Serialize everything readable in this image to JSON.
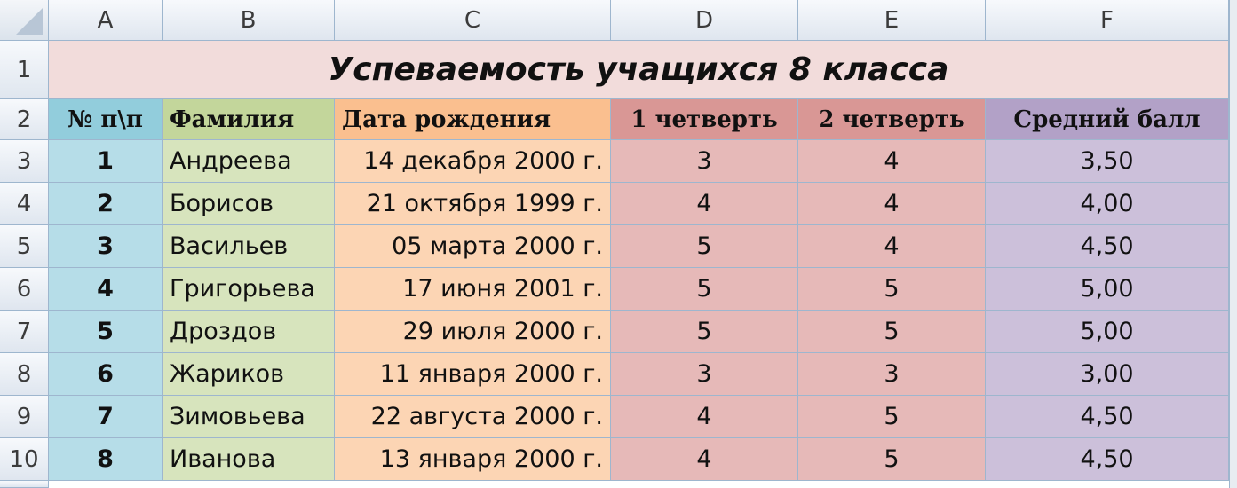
{
  "sheet": {
    "columns": [
      "A",
      "B",
      "C",
      "D",
      "E",
      "F"
    ],
    "rows": [
      "1",
      "2",
      "3",
      "4",
      "5",
      "6",
      "7",
      "8",
      "9",
      "10"
    ],
    "title": "Успеваемость учащихся 8 класса",
    "headers": [
      "№ п\\п",
      "Фамилия",
      "Дата рождения",
      "1 четверть",
      "2 четверть",
      "Средний балл"
    ],
    "data": [
      [
        "1",
        "Андреева",
        "14 декабря 2000 г.",
        "3",
        "4",
        "3,50"
      ],
      [
        "2",
        "Борисов",
        "21 октября 1999 г.",
        "4",
        "4",
        "4,00"
      ],
      [
        "3",
        "Васильев",
        "05 марта 2000 г.",
        "5",
        "4",
        "4,50"
      ],
      [
        "4",
        "Григорьева",
        "17 июня 2001 г.",
        "5",
        "5",
        "5,00"
      ],
      [
        "5",
        "Дроздов",
        "29 июля 2000 г.",
        "5",
        "5",
        "5,00"
      ],
      [
        "6",
        "Жариков",
        "11 января 2000 г.",
        "3",
        "3",
        "3,00"
      ],
      [
        "7",
        "Зимовьева",
        "22 августа 2000 г.",
        "4",
        "5",
        "4,50"
      ],
      [
        "8",
        "Иванова",
        "13 января 2000 г.",
        "4",
        "5",
        "4,50"
      ]
    ]
  },
  "colors": {
    "col_a": "#b6dde8",
    "col_b": "#d7e4bd",
    "col_c": "#fcd5b4",
    "col_d": "#e6b9b8",
    "col_e": "#e6b9b8",
    "col_f": "#ccc0da",
    "title_bg": "#f2dcdb"
  }
}
